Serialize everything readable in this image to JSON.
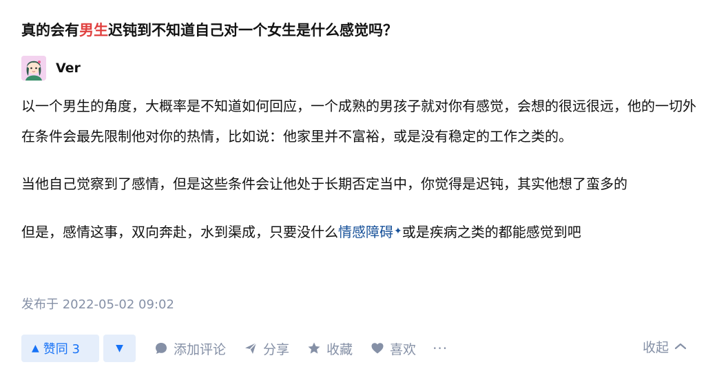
{
  "question": {
    "title_before": "真的会有",
    "title_highlight": "男生",
    "title_after": "迟钝到不知道自己对一个女生是什么感觉吗？"
  },
  "author": {
    "name": "Ver",
    "avatar_icon": "avatar-image"
  },
  "answer": {
    "para1": "以一个男生的角度，大概率是不知道如何回应，一个成熟的男孩子就对你有感觉，会想的很远很远，他的一切外在条件会最先限制他对你的热情，比如说：他家里并不富裕，或是没有稳定的工作之类的。",
    "para2": "当他自己觉察到了感情，但是这些条件会让他处于长期否定当中，你觉得是迟钝，其实他想了蛮多的",
    "para3_before": "但是，感情这事，双向奔赴，水到渠成，只要没什么",
    "para3_link": "情感障碍",
    "para3_after": "或是疾病之类的都能感觉到吧"
  },
  "meta": {
    "published": "发布于 2022-05-02 09:02"
  },
  "actions": {
    "upvote_label": "赞同 3",
    "comment_label": "添加评论",
    "share_label": "分享",
    "favorite_label": "收藏",
    "like_label": "喜欢",
    "more_label": "···",
    "collapse_label": "收起"
  },
  "colors": {
    "accent": "#1772f6",
    "accent_bg": "#e5eefb",
    "muted": "#8590a6",
    "highlight": "#e0403f",
    "link": "#175199"
  }
}
